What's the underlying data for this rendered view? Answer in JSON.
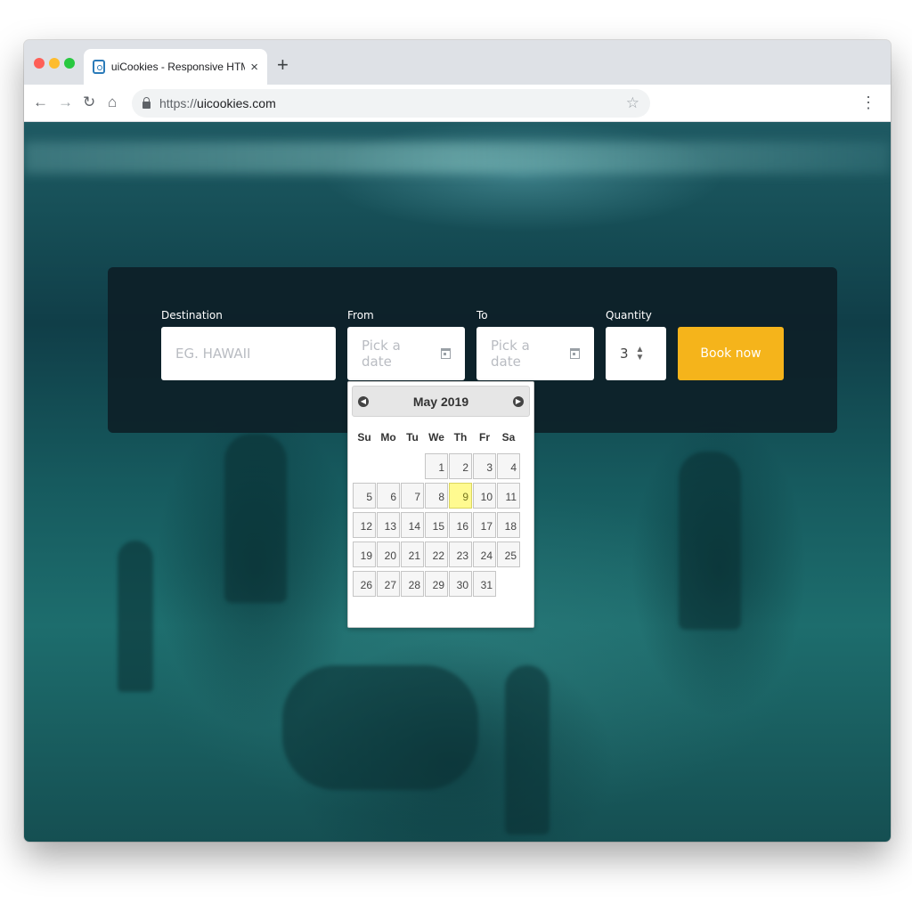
{
  "browser": {
    "tab_title": "uiCookies - Responsive HTML",
    "tab_close": "×",
    "new_tab": "+",
    "url_scheme": "https://",
    "url_host": "uicookies.com",
    "back": "←",
    "forward": "→",
    "reload": "↻",
    "home": "⌂",
    "bookmark": "☆",
    "menu": "⋮"
  },
  "booking": {
    "destination_label": "Destination",
    "destination_placeholder": "EG. HAWAII",
    "from_label": "From",
    "from_placeholder": "Pick a date",
    "to_label": "To",
    "to_placeholder": "Pick a date",
    "quantity_label": "Quantity",
    "quantity_value": "3",
    "book_label": "Book now"
  },
  "datepicker": {
    "title": "May 2019",
    "prev": "◀",
    "next": "▶",
    "weekdays": [
      "Su",
      "Mo",
      "Tu",
      "We",
      "Th",
      "Fr",
      "Sa"
    ],
    "weeks": [
      [
        "",
        "",
        "",
        "1",
        "2",
        "3",
        "4"
      ],
      [
        "5",
        "6",
        "7",
        "8",
        "9",
        "10",
        "11"
      ],
      [
        "12",
        "13",
        "14",
        "15",
        "16",
        "17",
        "18"
      ],
      [
        "19",
        "20",
        "21",
        "22",
        "23",
        "24",
        "25"
      ],
      [
        "26",
        "27",
        "28",
        "29",
        "30",
        "31",
        ""
      ]
    ],
    "highlighted_day": "9"
  },
  "colors": {
    "accent": "#f5b41b",
    "today_highlight": "#fffa90"
  }
}
